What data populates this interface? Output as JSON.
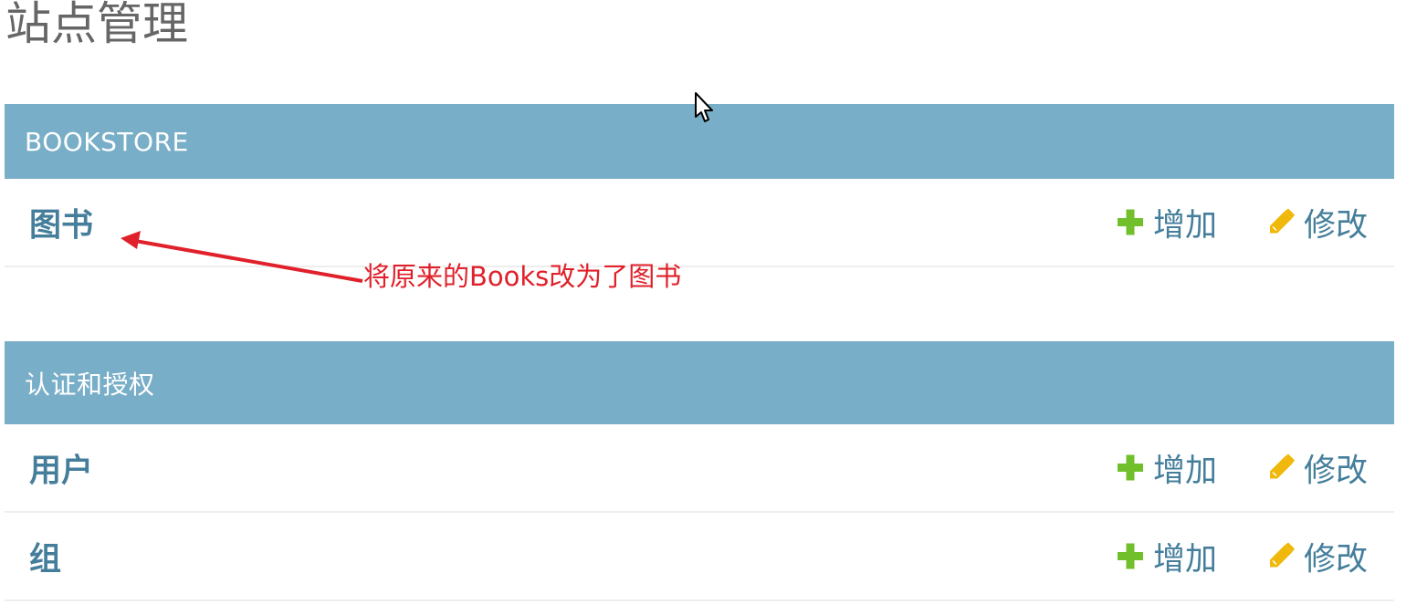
{
  "page": {
    "title": "站点管理"
  },
  "modules": [
    {
      "header": "BOOKSTORE",
      "models": [
        {
          "name": "图书",
          "add_label": "增加",
          "change_label": "修改"
        }
      ]
    },
    {
      "header": "认证和授权",
      "models": [
        {
          "name": "用户",
          "add_label": "增加",
          "change_label": "修改"
        },
        {
          "name": "组",
          "add_label": "增加",
          "change_label": "修改"
        }
      ]
    }
  ],
  "annotation": {
    "text": "将原来的Books改为了图书"
  },
  "icons": {
    "add": "plus-icon",
    "change": "pencil-icon",
    "cursor": "mouse-pointer-icon"
  },
  "colors": {
    "module_header_bg": "#79aec8",
    "link": "#447e9b",
    "add_icon": "#70bf2b",
    "change_icon": "#efb80b",
    "annotation": "#e0202a",
    "title": "#666666"
  }
}
